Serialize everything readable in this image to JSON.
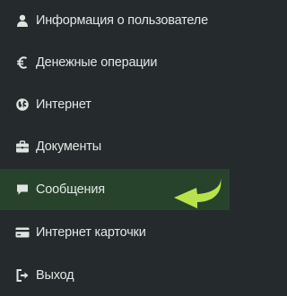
{
  "colors": {
    "background": "#252a2c",
    "active_background": "#27432c",
    "text": "#e3e7e4",
    "icon": "#dfe4e1",
    "arrow": "#b8e24b"
  },
  "menu": {
    "items": [
      {
        "label": "Информация о пользователе",
        "icon": "user-icon"
      },
      {
        "label": "Денежные операции",
        "icon": "euro-icon"
      },
      {
        "label": "Интернет",
        "icon": "globe-icon"
      },
      {
        "label": "Документы",
        "icon": "briefcase-icon"
      },
      {
        "label": "Сообщения",
        "icon": "comment-icon",
        "active": true
      },
      {
        "label": "Интернет карточки",
        "icon": "credit-card-icon"
      },
      {
        "label": "Выход",
        "icon": "sign-out-icon"
      }
    ]
  },
  "indicator": {
    "icon": "curved-arrow-icon"
  }
}
